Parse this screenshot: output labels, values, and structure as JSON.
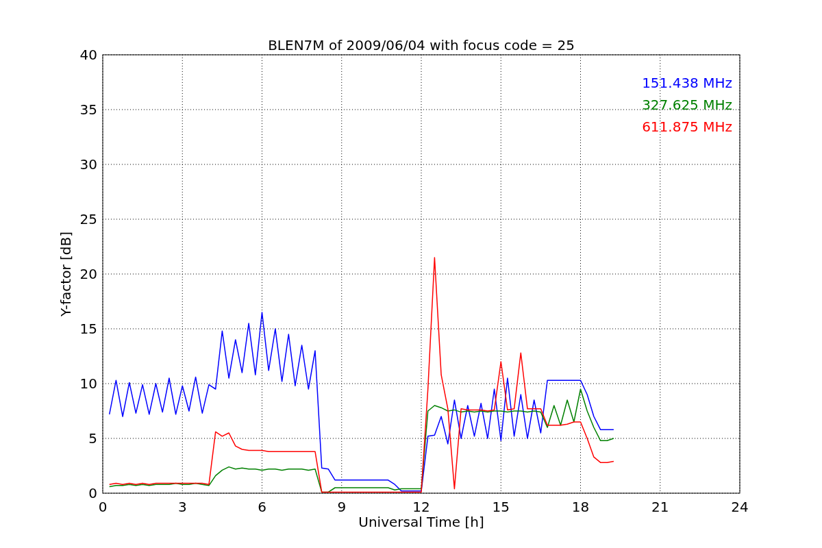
{
  "figure": {
    "chart_data": {
      "type": "line",
      "title": "BLEN7M of 2009/06/04 with focus code = 25",
      "xlabel": "Universal Time [h]",
      "ylabel": "Y-factor [dB]",
      "xlim": [
        0,
        24
      ],
      "ylim": [
        0,
        40
      ],
      "grid": true,
      "xticks": [
        0,
        3,
        6,
        9,
        12,
        15,
        18,
        21,
        24
      ],
      "yticks": [
        0,
        5,
        10,
        15,
        20,
        25,
        30,
        35,
        40
      ],
      "x": [
        0.25,
        0.5,
        0.75,
        1,
        1.25,
        1.5,
        1.75,
        2,
        2.25,
        2.5,
        2.75,
        3,
        3.25,
        3.5,
        3.75,
        4,
        4.25,
        4.5,
        4.75,
        5,
        5.25,
        5.5,
        5.75,
        6,
        6.25,
        6.5,
        6.75,
        7,
        7.25,
        7.5,
        7.75,
        8,
        8.25,
        8.5,
        8.75,
        9,
        9.25,
        9.5,
        9.75,
        10,
        10.25,
        10.5,
        10.75,
        11,
        11.25,
        11.5,
        11.75,
        12,
        12.25,
        12.5,
        12.75,
        13,
        13.25,
        13.5,
        13.75,
        14,
        14.25,
        14.5,
        14.75,
        15,
        15.25,
        15.5,
        15.75,
        16,
        16.25,
        16.5,
        16.75,
        17,
        17.25,
        17.5,
        17.75,
        18,
        18.25,
        18.5,
        18.75,
        19,
        19.25
      ],
      "series": [
        {
          "name": "151.438 MHz",
          "color": "#0000ff",
          "values": [
            7.2,
            10.3,
            7.0,
            10.1,
            7.3,
            9.9,
            7.2,
            10.0,
            7.4,
            10.5,
            7.2,
            9.8,
            7.5,
            10.6,
            7.3,
            9.9,
            9.5,
            14.8,
            10.5,
            14.0,
            11.0,
            15.5,
            10.8,
            16.5,
            11.2,
            15.0,
            10.2,
            14.5,
            9.8,
            13.5,
            9.5,
            13.0,
            2.3,
            2.2,
            1.2,
            1.2,
            1.2,
            1.2,
            1.2,
            1.2,
            1.2,
            1.2,
            1.2,
            0.8,
            0.2,
            0.2,
            0.2,
            0.2,
            5.2,
            5.3,
            7.0,
            4.5,
            8.5,
            5.0,
            8.0,
            5.2,
            8.2,
            5.0,
            9.5,
            4.8,
            10.5,
            5.2,
            9.0,
            5.0,
            8.5,
            5.5,
            10.3,
            10.3,
            10.3,
            10.3,
            10.3,
            10.3,
            9.0,
            7.0,
            5.8,
            5.8,
            5.8
          ]
        },
        {
          "name": "327.625 MHz",
          "color": "#008000",
          "values": [
            0.6,
            0.7,
            0.7,
            0.8,
            0.7,
            0.8,
            0.7,
            0.8,
            0.8,
            0.8,
            0.9,
            0.8,
            0.8,
            0.9,
            0.8,
            0.7,
            1.6,
            2.1,
            2.4,
            2.2,
            2.3,
            2.2,
            2.2,
            2.1,
            2.2,
            2.2,
            2.1,
            2.2,
            2.2,
            2.2,
            2.1,
            2.2,
            0.1,
            0.1,
            0.5,
            0.5,
            0.5,
            0.5,
            0.5,
            0.5,
            0.5,
            0.5,
            0.5,
            0.3,
            0.4,
            0.4,
            0.4,
            0.4,
            7.5,
            8.0,
            7.8,
            7.5,
            7.6,
            7.4,
            7.5,
            7.4,
            7.5,
            7.4,
            7.5,
            7.5,
            7.4,
            7.5,
            7.5,
            7.4,
            7.5,
            7.4,
            6.0,
            8.0,
            6.2,
            8.5,
            6.5,
            9.5,
            7.5,
            6.0,
            4.8,
            4.8,
            5.0
          ]
        },
        {
          "name": "611.875 MHz",
          "color": "#ff0000",
          "values": [
            0.8,
            0.9,
            0.8,
            0.9,
            0.8,
            0.9,
            0.8,
            0.9,
            0.9,
            0.9,
            0.9,
            0.9,
            0.9,
            0.9,
            0.9,
            0.8,
            5.6,
            5.2,
            5.5,
            4.3,
            4.0,
            3.9,
            3.9,
            3.9,
            3.8,
            3.8,
            3.8,
            3.8,
            3.8,
            3.8,
            3.8,
            3.8,
            0.1,
            0.1,
            0.1,
            0.1,
            0.1,
            0.1,
            0.1,
            0.1,
            0.1,
            0.1,
            0.1,
            0.1,
            0.1,
            0.1,
            0.1,
            0.1,
            9.5,
            21.5,
            10.8,
            7.7,
            0.4,
            7.7,
            7.6,
            7.6,
            7.6,
            7.5,
            7.6,
            12.0,
            7.6,
            7.7,
            12.8,
            7.7,
            7.7,
            7.7,
            6.2,
            6.2,
            6.2,
            6.3,
            6.5,
            6.5,
            5.0,
            3.3,
            2.8,
            2.8,
            2.9
          ]
        }
      ]
    }
  }
}
